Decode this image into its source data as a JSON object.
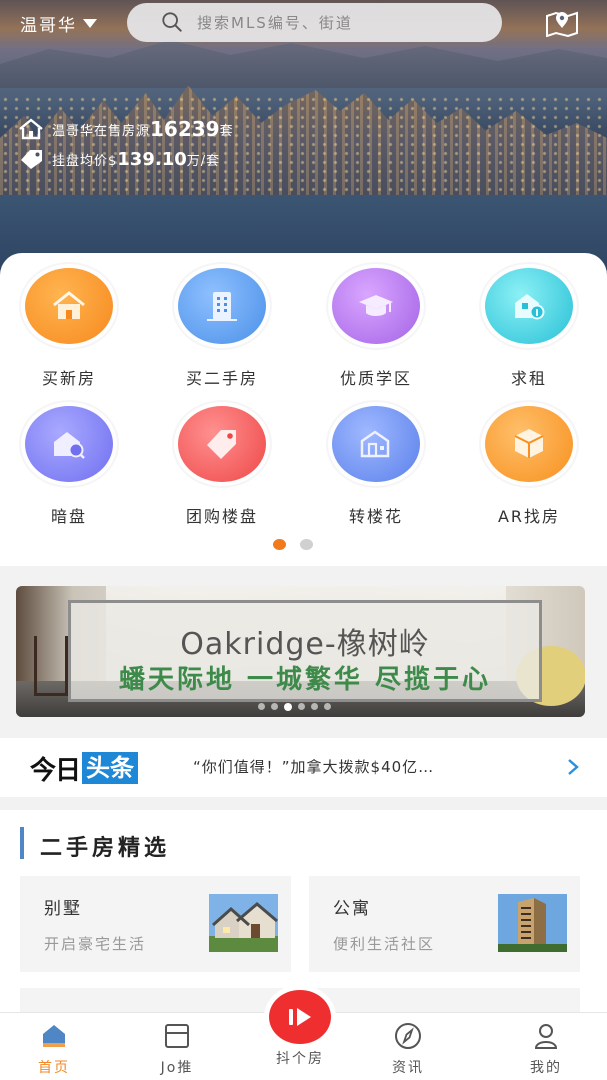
{
  "header": {
    "city": "温哥华",
    "search_placeholder": "搜索MLS编号、街道"
  },
  "stats": {
    "listings_prefix": "温哥华在售房源",
    "listings_count": "16239",
    "listings_unit": "套",
    "avg_price_prefix": "挂盘均价$",
    "avg_price_value": "139.10",
    "avg_price_unit": "万/套"
  },
  "categories": [
    {
      "label": "买新房",
      "icon": "house-icon",
      "color": "#f7891e"
    },
    {
      "label": "买二手房",
      "icon": "building-icon",
      "color": "#4a90e8"
    },
    {
      "label": "优质学区",
      "icon": "graduation-cap-icon",
      "color": "#a463e6"
    },
    {
      "label": "求租",
      "icon": "rental-key-icon",
      "color": "#27c0d6"
    },
    {
      "label": "暗盘",
      "icon": "hidden-listing-icon",
      "color": "#6f6ff0"
    },
    {
      "label": "团购楼盘",
      "icon": "tag-icon",
      "color": "#ef4747"
    },
    {
      "label": "转楼花",
      "icon": "presale-icon",
      "color": "#5a80ea"
    },
    {
      "label": "AR找房",
      "icon": "ar-cube-icon",
      "color": "#f7901e"
    }
  ],
  "banner": {
    "title": "Oakridge-橡树岭",
    "subtitle": "蟠天际地  一城繁华  尽揽于心"
  },
  "news": {
    "logo_part1": "今日",
    "logo_part2": "头条",
    "headline": "“你们值得！”加拿大拨款$40亿…"
  },
  "section": {
    "heading": "二手房精选",
    "cards": [
      {
        "title": "别墅",
        "desc": "开启豪宅生活"
      },
      {
        "title": "公寓",
        "desc": "便利生活社区"
      }
    ]
  },
  "tabbar": {
    "home": "首页",
    "jo": "Jo推",
    "center": "抖个房",
    "news": "资讯",
    "me": "我的"
  },
  "colors": {
    "accent": "#f07a1c",
    "primary_blue": "#4f86c6",
    "center_red": "#ef2f2f"
  }
}
